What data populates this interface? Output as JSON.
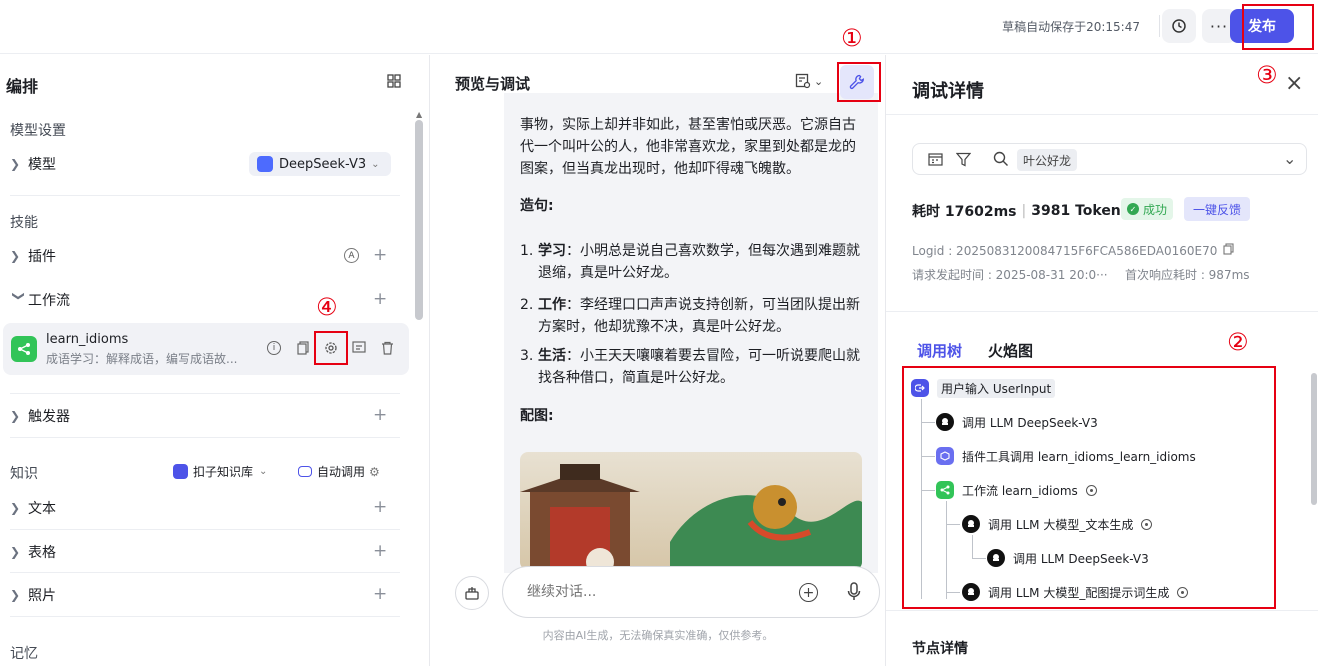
{
  "topbar": {
    "autosave": "草稿自动保存于20:15:47",
    "publish_label": "发布"
  },
  "annotations": {
    "a1": "①",
    "a2": "②",
    "a3": "③",
    "a4": "④"
  },
  "left": {
    "title": "编排",
    "model_section": "模型设置",
    "model_label": "模型",
    "model_value": "DeepSeek-V3",
    "skills_section": "技能",
    "plugin_label": "插件",
    "workflow_label": "工作流",
    "workflow_item": {
      "name": "learn_idioms",
      "desc": "成语学习：解释成语，编写成语故..."
    },
    "trigger_label": "触发器",
    "knowledge_section": "知识",
    "kb_selector": "扣子知识库",
    "auto_call": "自动调用",
    "text_label": "文本",
    "table_label": "表格",
    "photo_label": "照片",
    "memory_section": "记忆"
  },
  "middle": {
    "title": "预览与调试",
    "para1": "事物，实际上却并非如此，甚至害怕或厌恶。它源自古代一个叫叶公的人，他非常喜欢龙，家里到处都是龙的图案，但当真龙出现时，他却吓得魂飞魄散。",
    "example_heading": "造句:",
    "examples": [
      {
        "num": "1.",
        "key": "学习",
        "text": "：小明总是说自己喜欢数学，但每次遇到难题就退缩，真是叶公好龙。"
      },
      {
        "num": "2.",
        "key": "工作",
        "text": "：李经理口口声声说支持创新，可当团队提出新方案时，他却犹豫不决，真是叶公好龙。"
      },
      {
        "num": "3.",
        "key": "生活",
        "text": "：小王天天嚷嚷着要去冒险，可一听说要爬山就找各种借口，简直是叶公好龙。"
      }
    ],
    "image_heading": "配图:",
    "input_placeholder": "继续对话...",
    "hint": "内容由AI生成，无法确保真实准确，仅供参考。"
  },
  "right": {
    "title": "调试详情",
    "search_tag": "叶公好龙",
    "duration": "耗时 17602ms",
    "tokens": "3981 Tokens",
    "status": "成功",
    "feedback": "一键反馈",
    "logid": "Logid : 2025083120084715F6FCA586EDA0160E70",
    "req_time": "请求发起时间 : 2025-08-31 20:0···",
    "first_resp": "首次响应耗时 : 987ms",
    "tabs": [
      "调用树",
      "火焰图"
    ],
    "tree": [
      "用户输入 UserInput",
      "调用 LLM DeepSeek-V3",
      "插件工具调用 learn_idioms_learn_idioms",
      "工作流 learn_idioms",
      "调用 LLM 大模型_文本生成",
      "调用 LLM DeepSeek-V3",
      "调用 LLM 大模型_配图提示词生成"
    ],
    "node_details": "节点详情"
  },
  "colors": {
    "accent": "#4d53e8",
    "annotation": "#e60012",
    "success": "#32a852"
  }
}
